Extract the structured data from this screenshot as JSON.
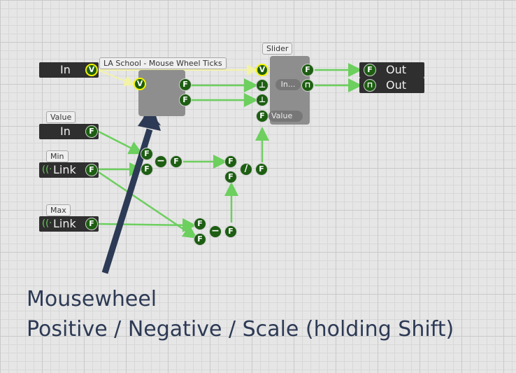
{
  "graph": {
    "title_tag": "LA School - Mouse Wheel Ticks",
    "slider_tag": "Slider",
    "in_node": {
      "label": "In",
      "port": "V"
    },
    "value_node": {
      "tag": "Value",
      "label": "In",
      "port": "F"
    },
    "min_node": {
      "tag": "Min",
      "label": "Link",
      "port": "F"
    },
    "max_node": {
      "tag": "Max",
      "label": "Link",
      "port": "F"
    },
    "center_node": {
      "in_port": "V",
      "out_ports": [
        "F",
        "F"
      ]
    },
    "slider_node": {
      "pill_in": "In...",
      "value_label": "Value",
      "in_port": "V",
      "port_f": "F"
    },
    "subtract_top": {
      "op": "−",
      "in": [
        "F",
        "F"
      ],
      "out": "F"
    },
    "subtract_bottom": {
      "op": "−",
      "in": [
        "F",
        "F"
      ],
      "out": "F"
    },
    "divide": {
      "op": "/",
      "in": [
        "F",
        "F"
      ],
      "out": "F"
    },
    "out_nodes": [
      {
        "label": "Out",
        "port": "F"
      },
      {
        "label": "Out",
        "port": "⊓"
      }
    ]
  },
  "caption": {
    "line1": "Mousewheel",
    "line2": "Positive / Negative / Scale (holding Shift)"
  },
  "colors": {
    "wire": "#6ccf5e",
    "wire_yellow": "#f3f3a6",
    "port_fill": "#1d5e12",
    "arrow": "#2d3a55"
  }
}
